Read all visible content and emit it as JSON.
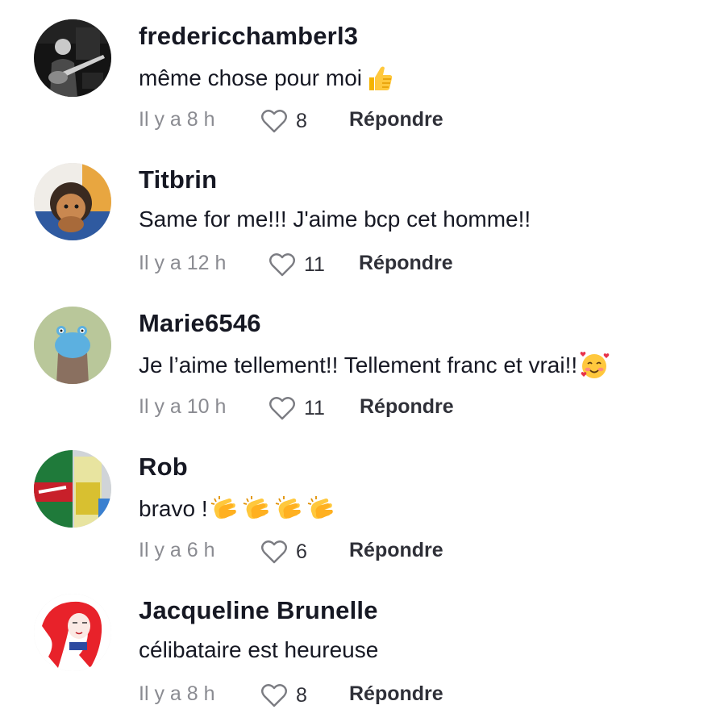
{
  "reply_label": "Répondre",
  "comments": [
    {
      "username": "fredericchamberl3",
      "text": "même chose pour moi",
      "emojis": [
        "thumbs-up"
      ],
      "timestamp": "Il y a 8 h",
      "likes": "8"
    },
    {
      "username": "Titbrin",
      "text": "Same for me!!! J'aime bcp cet homme!!",
      "emojis": [],
      "timestamp": "Il y a 12 h",
      "likes": "11"
    },
    {
      "username": "Marie6546",
      "text": "Je l’aime tellement!! Tellement franc et vrai!! ",
      "emojis": [
        "smiling-face-with-hearts"
      ],
      "timestamp": "Il y a 10 h",
      "likes": "11"
    },
    {
      "username": "Rob",
      "text": "bravo ! ",
      "emojis": [
        "clapping-hands",
        "clapping-hands",
        "clapping-hands",
        "clapping-hands"
      ],
      "timestamp": "Il y a 6 h",
      "likes": "6"
    },
    {
      "username": "Jacqueline Brunelle",
      "text": "célibataire est heureuse",
      "emojis": [],
      "timestamp": "Il y a 8 h",
      "likes": "8"
    }
  ]
}
